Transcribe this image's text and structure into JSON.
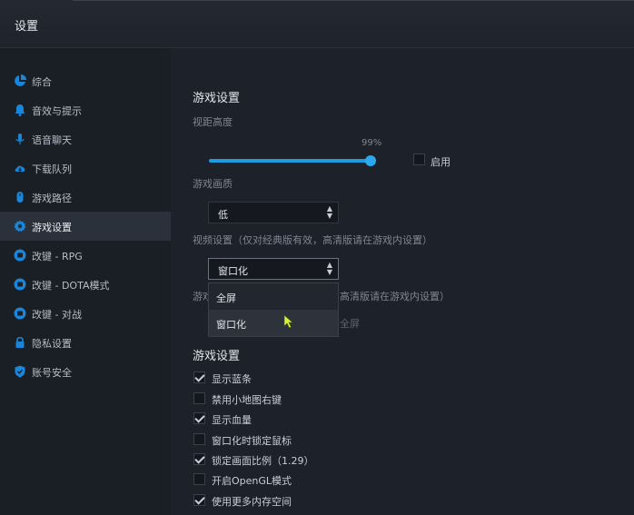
{
  "window": {
    "title": "设置"
  },
  "sidebar": {
    "items": [
      {
        "label": "综合",
        "icon": "pie-chart-icon"
      },
      {
        "label": "音效与提示",
        "icon": "bell-icon"
      },
      {
        "label": "语音聊天",
        "icon": "microphone-icon"
      },
      {
        "label": "下载队列",
        "icon": "cloud-download-icon"
      },
      {
        "label": "游戏路径",
        "icon": "mouse-icon"
      },
      {
        "label": "游戏设置",
        "icon": "gear-icon",
        "active": true
      },
      {
        "label": "改键 - RPG",
        "icon": "keyboard-badge-icon"
      },
      {
        "label": "改键 - DOTA模式",
        "icon": "keyboard-badge-icon"
      },
      {
        "label": "改键 - 对战",
        "icon": "keyboard-badge-icon"
      },
      {
        "label": "隐私设置",
        "icon": "lock-icon"
      },
      {
        "label": "账号安全",
        "icon": "shield-icon"
      }
    ]
  },
  "game": {
    "section_title": "游戏设置",
    "view_height_label": "视距高度",
    "view_height_percent": "99%",
    "view_height_value": 0.99,
    "enable_label": "启用",
    "enable_checked": false,
    "quality_label": "游戏画质",
    "quality_value": "低",
    "video_label": "视频设置（仅对经典版有效，高清版请在游戏内设置）",
    "video_value": "窗口化",
    "video_options": [
      "全屏",
      "窗口化"
    ],
    "hidden_label_start": "游戏",
    "hidden_label_end": "高清版请在游戏内设置）",
    "hidden_value_tail": "全屏"
  },
  "options": {
    "section_title": "游戏设置",
    "items": [
      {
        "label": "显示蓝条",
        "checked": true
      },
      {
        "label": "禁用小地图右键",
        "checked": false
      },
      {
        "label": "显示血量",
        "checked": true
      },
      {
        "label": "窗口化时锁定鼠标",
        "checked": false
      },
      {
        "label": "锁定画面比例（1.29）",
        "checked": true
      },
      {
        "label": "开启OpenGL模式",
        "checked": false
      },
      {
        "label": "使用更多内存空间",
        "checked": true
      }
    ]
  },
  "colors": {
    "accent": "#1e9be0",
    "icon": "#1a86d8",
    "background": "#1d2129"
  }
}
